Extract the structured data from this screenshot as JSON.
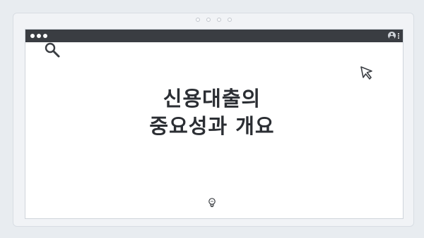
{
  "window": {
    "controls": [
      "close",
      "minimize",
      "maximize"
    ],
    "menu_icons": [
      "user-icon",
      "kebab-menu-icon"
    ]
  },
  "content": {
    "title_line1": "신용대출의",
    "title_line2": "중요성과 개요"
  },
  "icons": {
    "top_left": "search-icon",
    "top_right": "cursor-icon",
    "bottom": "lightbulb-icon"
  },
  "colors": {
    "titlebar": "#3a3d42",
    "text": "#2b2e33",
    "background": "#e8ecf0"
  }
}
